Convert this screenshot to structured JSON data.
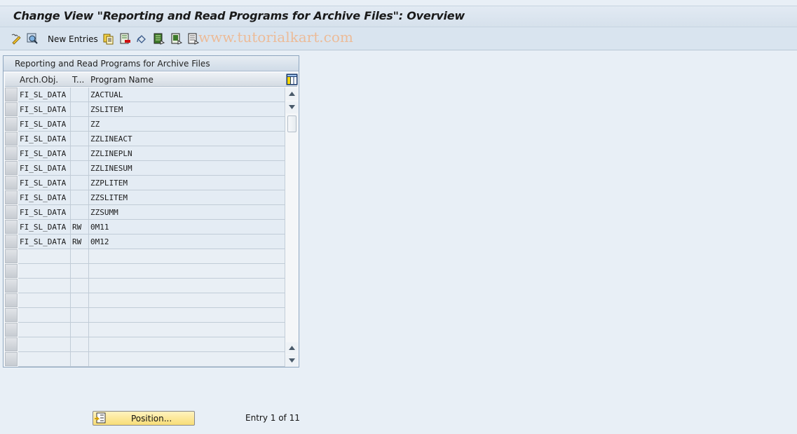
{
  "window": {
    "title": "Change View \"Reporting and Read Programs for Archive Files\": Overview"
  },
  "toolbar": {
    "icons": [
      "display-change-icon",
      "select-detail-icon",
      "copy-as-icon",
      "delete-icon",
      "undo-change-icon",
      "select-all-icon",
      "select-block-icon",
      "deselect-all-icon"
    ],
    "new_entries_label": "New Entries",
    "watermark": "www.tutorialkart.com"
  },
  "panel": {
    "title": "Reporting and Read Programs for Archive Files",
    "columns": [
      "Arch.Obj.",
      "T...",
      "Program Name"
    ],
    "rows": [
      {
        "arch_obj": "FI_SL_DATA",
        "type": "",
        "program": "ZACTUAL"
      },
      {
        "arch_obj": "FI_SL_DATA",
        "type": "",
        "program": "ZSLITEM"
      },
      {
        "arch_obj": "FI_SL_DATA",
        "type": "",
        "program": "ZZ"
      },
      {
        "arch_obj": "FI_SL_DATA",
        "type": "",
        "program": "ZZLINEACT"
      },
      {
        "arch_obj": "FI_SL_DATA",
        "type": "",
        "program": "ZZLINEPLN"
      },
      {
        "arch_obj": "FI_SL_DATA",
        "type": "",
        "program": "ZZLINESUM"
      },
      {
        "arch_obj": "FI_SL_DATA",
        "type": "",
        "program": "ZZPLITEM"
      },
      {
        "arch_obj": "FI_SL_DATA",
        "type": "",
        "program": "ZZSLITEM"
      },
      {
        "arch_obj": "FI_SL_DATA",
        "type": "",
        "program": "ZZSUMM"
      },
      {
        "arch_obj": "FI_SL_DATA",
        "type": "RW",
        "program": "0M11"
      },
      {
        "arch_obj": "FI_SL_DATA",
        "type": "RW",
        "program": "0M12"
      }
    ],
    "empty_rows": 8
  },
  "footer": {
    "position_label": "Position...",
    "entry_text": "Entry 1 of 11"
  }
}
